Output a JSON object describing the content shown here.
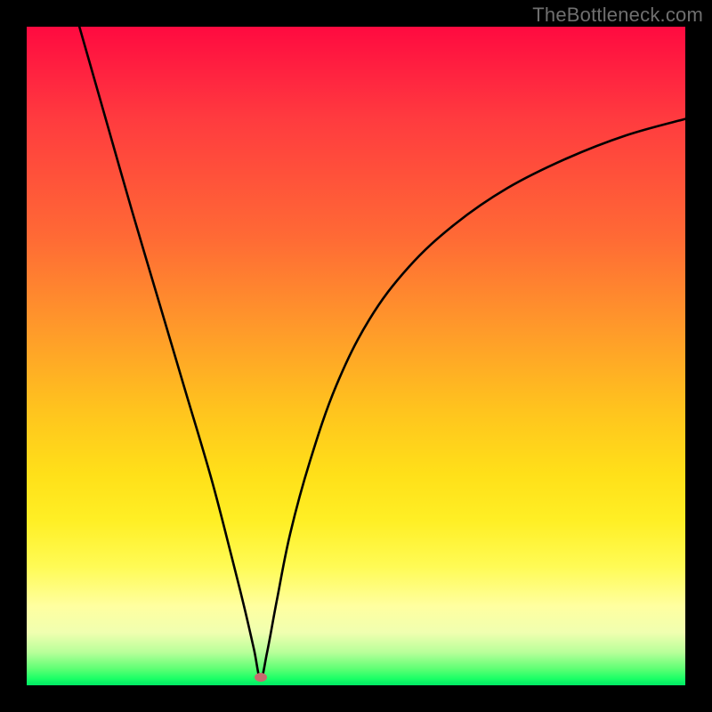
{
  "watermark": "TheBottleneck.com",
  "chart_data": {
    "type": "line",
    "title": "",
    "xlabel": "",
    "ylabel": "",
    "xlim": [
      0,
      100
    ],
    "ylim": [
      0,
      100
    ],
    "background_gradient": {
      "top": "#ff0a40",
      "mid_upper": "#ff9a2a",
      "mid_lower": "#ffe019",
      "bottom": "#00e865"
    },
    "marker": {
      "x": 35.5,
      "y": 1.2,
      "color": "#c86b6e"
    },
    "series": [
      {
        "name": "bottleneck-curve",
        "x": [
          8,
          12,
          16,
          20,
          24,
          28,
          31,
          33,
          34.5,
          35.5,
          36.5,
          38,
          40,
          43,
          47,
          52,
          58,
          65,
          73,
          82,
          91,
          100
        ],
        "y": [
          100,
          86,
          72,
          58.5,
          45,
          31.5,
          20,
          12,
          5.5,
          1,
          5,
          13,
          23,
          34,
          45.5,
          55.5,
          63.5,
          70,
          75.5,
          80,
          83.5,
          86
        ]
      }
    ],
    "annotations": []
  }
}
